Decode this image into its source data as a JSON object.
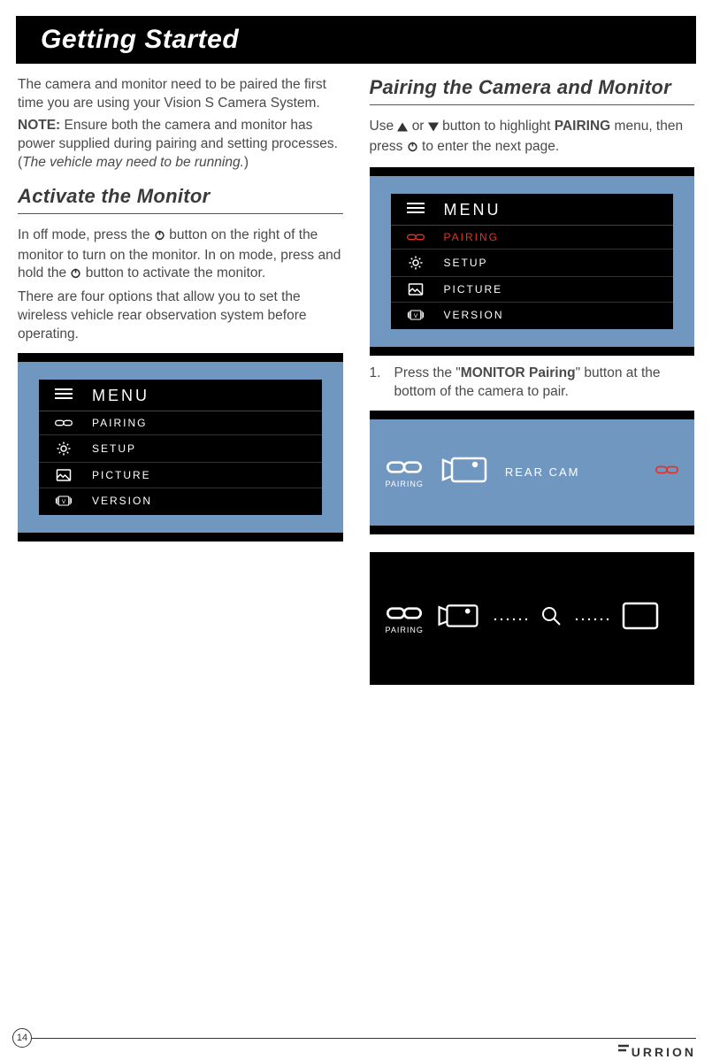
{
  "header": {
    "title": "Getting Started"
  },
  "left": {
    "intro1": "The camera and monitor need to be paired the first time you are using your Vision S Camera System.",
    "note_label": "NOTE:",
    "note_text": " Ensure both the camera and monitor has power supplied during pairing and setting processes. (",
    "note_italic": "The vehicle may need to be running.",
    "note_close": ")",
    "heading": "Activate the Monitor",
    "p2a": "In off mode, press the ",
    "p2b": " button on the right of the monitor to turn on the monitor. In on mode, press and hold the ",
    "p2c": " button to activate the monitor.",
    "p3": "There are four options that allow you to set the wireless vehicle rear observation system before operating."
  },
  "right": {
    "heading": "Pairing the Camera and Monitor",
    "p1a": "Use ",
    "p1b": " or ",
    "p1c": " button to highlight ",
    "p1d": "PAIRING",
    "p1e": " menu, then press ",
    "p1f": " to enter the next page.",
    "step1_num": "1.",
    "step1a": "Press the \"",
    "step1b": "MONITOR Pairing",
    "step1c": "\" button at the bottom of the camera to pair."
  },
  "menu": {
    "title": "MENU",
    "items": [
      {
        "label": "PAIRING"
      },
      {
        "label": "SETUP"
      },
      {
        "label": "PICTURE"
      },
      {
        "label": "VERSION"
      }
    ]
  },
  "pairing_screen": {
    "pairing_label": "PAIRING",
    "cam": "REAR CAM"
  },
  "footer": {
    "page": "14",
    "brand": "URRION"
  }
}
